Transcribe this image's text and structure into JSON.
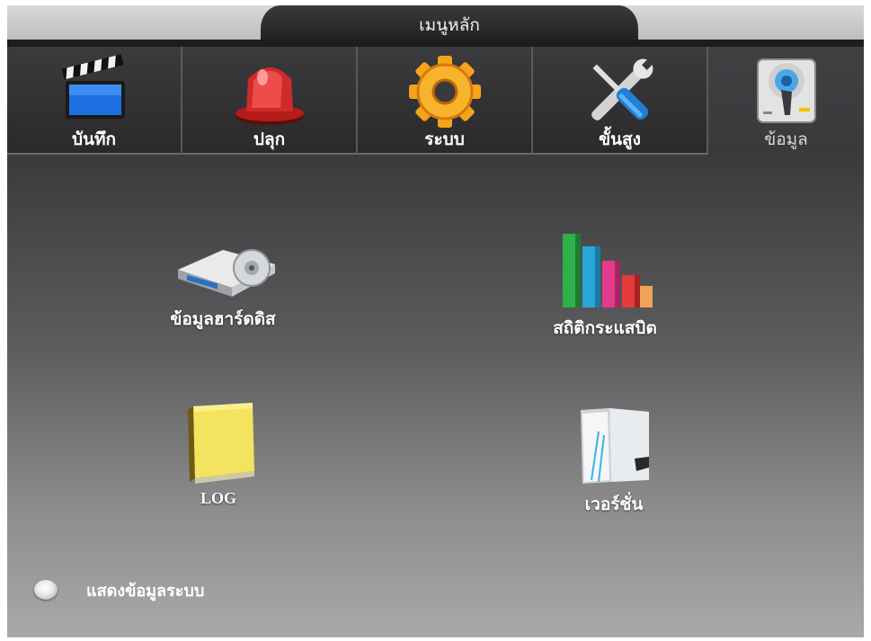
{
  "title": "เมนูหลัก",
  "tabs": [
    {
      "label": "บันทึก",
      "icon": "clapperboard-icon"
    },
    {
      "label": "ปลุก",
      "icon": "alarm-siren-icon"
    },
    {
      "label": "ระบบ",
      "icon": "gear-icon"
    },
    {
      "label": "ขั้นสูง",
      "icon": "wrench-screwdriver-icon"
    },
    {
      "label": "ข้อมูล",
      "icon": "hard-drive-info-icon",
      "active": true
    }
  ],
  "items": {
    "hdd": {
      "label": "ข้อมูลฮาร์ดดิส",
      "icon": "hard-disk-icon"
    },
    "stats": {
      "label": "สถิติกระแสบิต",
      "icon": "bar-chart-icon"
    },
    "log": {
      "label": "LOG",
      "icon": "log-book-icon"
    },
    "version": {
      "label": "เวอร์ชั่น",
      "icon": "version-folder-icon"
    }
  },
  "show_info": {
    "label": "แสดงข้อมูลระบบ",
    "checked": false
  },
  "colors": {
    "accent_active_tab": "#404043",
    "background_top": "#2e2e30",
    "background_bottom": "#a9a9aa"
  }
}
